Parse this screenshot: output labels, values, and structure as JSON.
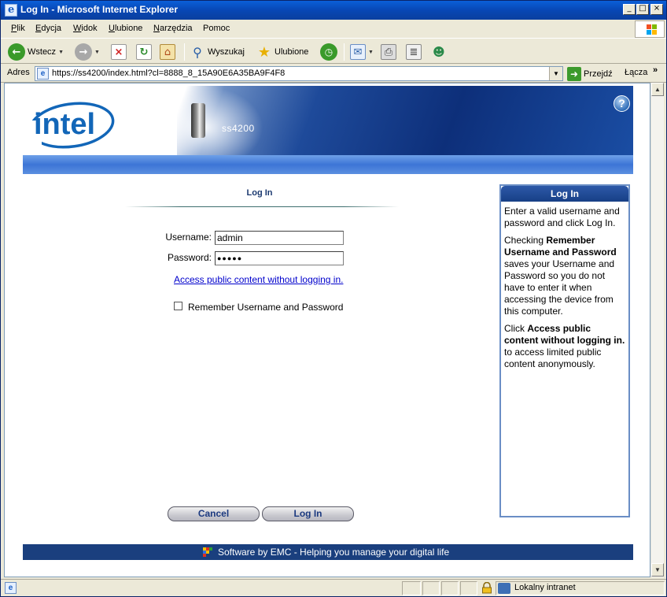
{
  "window": {
    "title": "Log In - Microsoft Internet Explorer",
    "controls": [
      "_",
      "□",
      "×"
    ]
  },
  "menubar": {
    "items": [
      {
        "label": "Plik",
        "accel": "P",
        "rest": "lik"
      },
      {
        "label": "Edycja",
        "accel": "E",
        "rest": "dycja"
      },
      {
        "label": "Widok",
        "accel": "W",
        "rest": "idok"
      },
      {
        "label": "Ulubione",
        "accel": "U",
        "rest": "lubione"
      },
      {
        "label": "Narzędzia",
        "accel": "N",
        "rest": "arzędzia"
      },
      {
        "label": "Pomoc",
        "accel": "",
        "rest": "Pomoc"
      }
    ]
  },
  "toolbar": {
    "back_label": "Wstecz",
    "search_label": "Wyszukaj",
    "favorites_label": "Ulubione"
  },
  "addressbar": {
    "label": "Adres",
    "url": "https://ss4200/index.html?cl=8888_8_15A90E6A35BA9F4F8",
    "go_label": "Przejdź",
    "links_label": "Łącza",
    "links_chevron": "»"
  },
  "header": {
    "brand": "intel",
    "device_name": "ss4200",
    "help_symbol": "?"
  },
  "login": {
    "title": "Log In",
    "username_label": "Username:",
    "username_value": "admin",
    "password_label": "Password:",
    "password_mask": "●●●●●",
    "public_link": "Access public content without logging in.",
    "remember_label": "Remember Username and Password",
    "cancel_label": "Cancel",
    "login_label": "Log In"
  },
  "sidebar": {
    "title": "Log In",
    "p1": "Enter a valid username and password and click Log In.",
    "p2_pre": "Checking ",
    "p2_bold": "Remember Username and Password",
    "p2_post": " saves your Username and Password so you do not have to enter it when accessing the device from this computer.",
    "p3_pre": "Click ",
    "p3_bold": "Access public content without logging in.",
    "p3_post": " to access limited public content anonymously."
  },
  "footer": {
    "text": "Software by EMC - Helping you manage your digital life"
  },
  "statusbar": {
    "zone": "Lokalny intranet"
  },
  "colors": {
    "titlebar": "#0a5fd8",
    "header_blue": "#0d2f7a",
    "footer": "#1a3f7e",
    "link": "#0000cc"
  }
}
